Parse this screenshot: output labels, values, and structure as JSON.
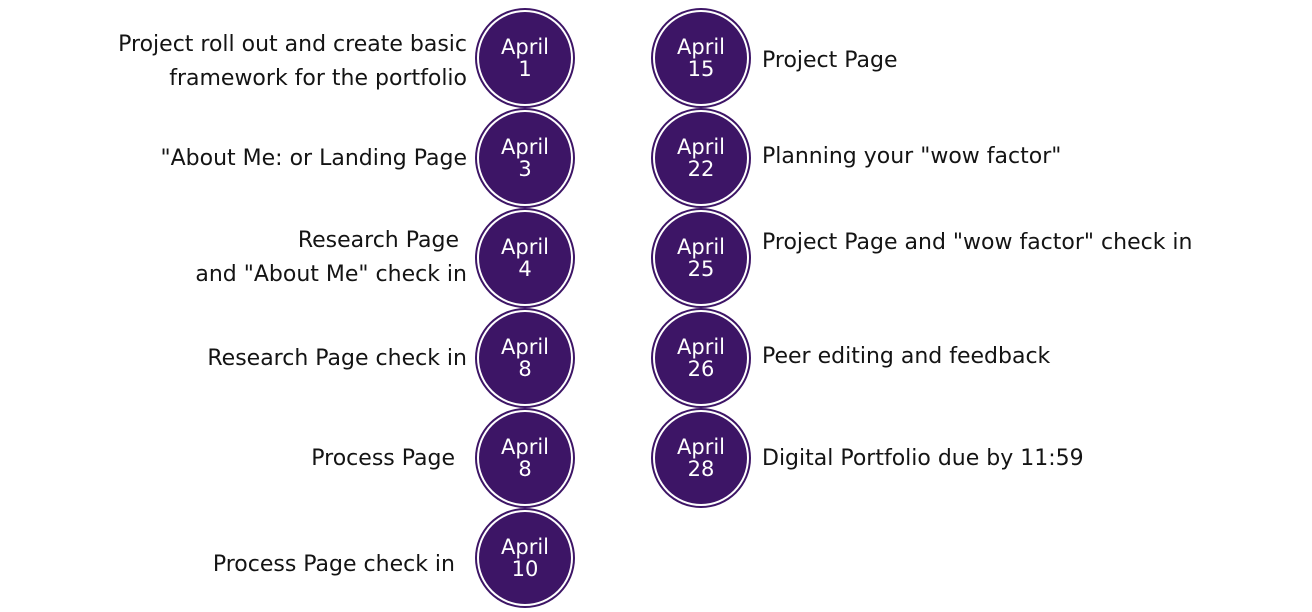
{
  "accent_color": "#3d1566",
  "left_column": [
    {
      "month": "April",
      "day": "1",
      "lines": [
        "Project roll out and  create basic",
        "framework for the portfolio"
      ]
    },
    {
      "month": "April",
      "day": "3",
      "lines": [
        "\"About Me: or Landing Page"
      ]
    },
    {
      "month": "April",
      "day": "4",
      "lines": [
        "Research  Page",
        "and  \"About Me\" check in"
      ]
    },
    {
      "month": "April",
      "day": "8",
      "lines": [
        "Research Page check in"
      ]
    },
    {
      "month": "April",
      "day": "8",
      "lines": [
        "Process Page"
      ]
    },
    {
      "month": "April",
      "day": "10",
      "lines": [
        "Process Page check in"
      ]
    }
  ],
  "right_column": [
    {
      "month": "April",
      "day": "15",
      "lines": [
        "Project Page"
      ]
    },
    {
      "month": "April",
      "day": "22",
      "lines": [
        "Planning your \"wow factor\""
      ]
    },
    {
      "month": "April",
      "day": "25",
      "lines": [
        "Project Page and \"wow factor\" check in"
      ]
    },
    {
      "month": "April",
      "day": "26",
      "lines": [
        "Peer editing and feedback"
      ]
    },
    {
      "month": "April",
      "day": "28",
      "lines": [
        "Digital Portfolio due by 11:59"
      ]
    }
  ]
}
